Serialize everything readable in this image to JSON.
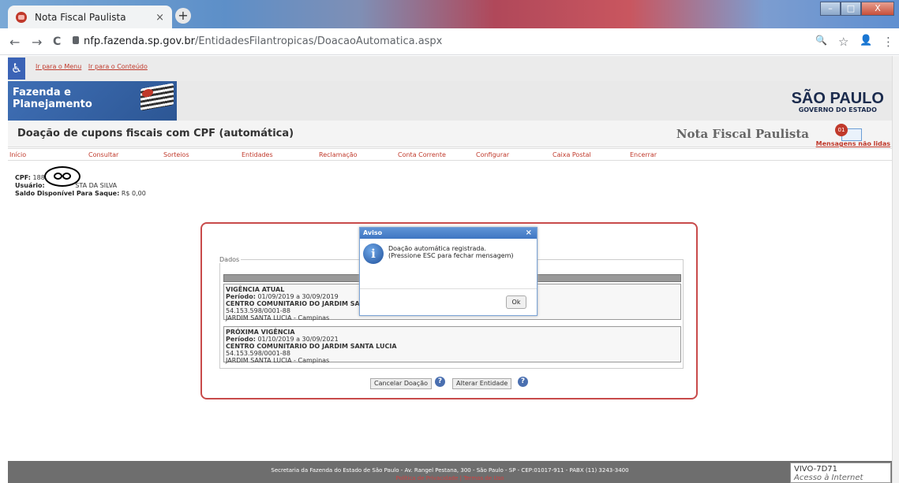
{
  "browser": {
    "tab_title": "Nota Fiscal Paulista",
    "tab_close": "×",
    "new_tab": "+",
    "url_host": "nfp.fazenda.sp.gov.br",
    "url_path": "/EntidadesFilantropicas/DoacaoAutomatica.aspx",
    "back": "←",
    "forward": "→",
    "reload": "C",
    "zoom": "🔍",
    "star": "☆",
    "account": "👤",
    "menu": "⋮",
    "win_min": "–",
    "win_max": "□",
    "win_close": "X"
  },
  "accessibility": {
    "icon": "♿",
    "link_menu": "Ir para o Menu",
    "link_content": "Ir para o Conteúdo"
  },
  "banner": {
    "org_line1": "Fazenda e",
    "org_line2": "Planejamento",
    "sp_big": "SÃO PAULO",
    "sp_small": "GOVERNO DO ESTADO"
  },
  "header": {
    "page_title": "Doação de cupons fiscais com CPF (automática)",
    "app_title": "Nota Fiscal Paulista",
    "msg_badge": "01",
    "msg_label": "Mensagens não lidas"
  },
  "menu": [
    "Início",
    "Consultar",
    "Sorteios",
    "Entidades",
    "Reclamação",
    "Conta Corrente",
    "Configurar",
    "Caixa Postal",
    "Encerrar"
  ],
  "user": {
    "cpf_label": "CPF:",
    "cpf_value": "188",
    "user_label": "Usuário:",
    "user_value": "STA DA SILVA",
    "saldo_label": "Saldo Disponível Para Saque:",
    "saldo_value": "R$ 0,00"
  },
  "panel": {
    "legend": "Dados",
    "atual": {
      "title": "VIGÊNCIA ATUAL",
      "periodo_label": "Período:",
      "periodo": "01/09/2019 a 30/09/2019",
      "entidade": "CENTRO COMUNITARIO DO JARDIM SANT",
      "cnpj": "54.153.598/0001-88",
      "local": "JARDIM SANTA LUCIA  -  Campinas"
    },
    "proxima": {
      "title": "PRÓXIMA VIGÊNCIA",
      "periodo_label": "Período:",
      "periodo": "01/10/2019 a 30/09/2021",
      "entidade": "CENTRO COMUNITARIO DO JARDIM SANTA LUCIA",
      "cnpj": "54.153.598/0001-88",
      "local": "JARDIM SANTA LUCIA  -  Campinas"
    },
    "btn_cancel": "Cancelar Doação",
    "btn_alter": "Alterar Entidade",
    "help": "?"
  },
  "dialog": {
    "title": "Aviso",
    "close": "×",
    "info": "i",
    "line1": "Doação automática registrada.",
    "line2": "(Pressione ESC para fechar mensagem)",
    "ok": "Ok"
  },
  "footer": {
    "address": "Secretaria da Fazenda do Estado de São Paulo - Av. Rangel Pestana, 300 - São Paulo - SP - CEP:01017-911 - PABX (11) 3243-3400",
    "link1": "Política de Privacidade",
    "sep": "|",
    "link2": "Termos de Uso"
  },
  "network": {
    "name": "VIVO-7D71",
    "status": "Acesso à Internet"
  }
}
